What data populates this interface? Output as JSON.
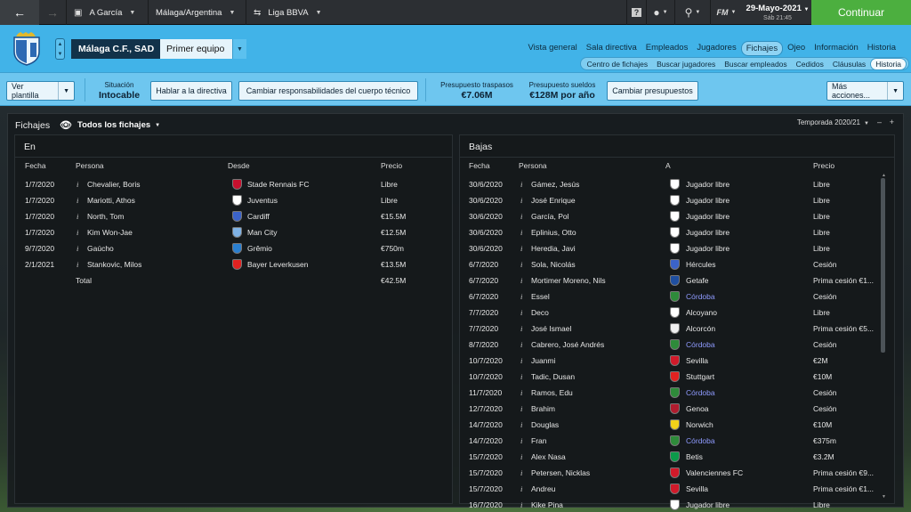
{
  "topbar": {
    "breadcrumbs": [
      {
        "label": "A García",
        "icon": "car-icon"
      },
      {
        "label": "Málaga/Argentina",
        "icon": "none"
      },
      {
        "label": "Liga BBVA",
        "icon": "swap-icon"
      }
    ],
    "date": "29-Mayo-2021",
    "time": "Sáb 21:45",
    "fm_label": "FM",
    "continue_label": "Continuar"
  },
  "header": {
    "club_name": "Málaga C.F., SAD",
    "team": "Primer equipo",
    "tabs": [
      "Vista general",
      "Sala directiva",
      "Empleados",
      "Jugadores",
      "Fichajes",
      "Ojeo",
      "Información",
      "Historia"
    ],
    "active_tab": "Fichajes",
    "subtabs": [
      "Centro de fichajes",
      "Buscar jugadores",
      "Buscar empleados",
      "Cedidos",
      "Cláusulas",
      "Historia"
    ],
    "active_subtab": "Historia"
  },
  "toolbar": {
    "squad_btn": "Ver plantilla",
    "situation_label": "Situación",
    "situation_value": "Intocable",
    "board_btn": "Hablar a la directiva",
    "staff_btn": "Cambiar responsabilidades del cuerpo técnico",
    "transfer_budget_label": "Presupuesto traspasos",
    "transfer_budget_value": "€7.06M",
    "wage_budget_label": "Presupuesto sueldos",
    "wage_budget_value": "€128M por año",
    "budget_btn": "Cambiar presupuestos",
    "more_btn": "Más acciones..."
  },
  "panel": {
    "title": "Fichajes",
    "filter": "Todos los fichajes",
    "season": "Temporada 2020/21"
  },
  "in": {
    "title": "En",
    "headers": {
      "date": "Fecha",
      "person": "Persona",
      "from": "Desde",
      "fee": "Precio"
    },
    "rows": [
      {
        "date": "1/7/2020",
        "person": "Chevalier, Boris",
        "club": "Stade Rennais FC",
        "fee": "Libre",
        "color": "#c8102e"
      },
      {
        "date": "1/7/2020",
        "person": "Mariotti, Athos",
        "club": "Juventus",
        "fee": "Libre",
        "color": "#ffffff"
      },
      {
        "date": "1/7/2020",
        "person": "North, Tom",
        "club": "Cardiff",
        "fee": "€15.5M",
        "color": "#3b63c9"
      },
      {
        "date": "1/7/2020",
        "person": "Kim Won-Jae",
        "club": "Man City",
        "fee": "€12.5M",
        "color": "#7fb2e5"
      },
      {
        "date": "9/7/2020",
        "person": "Gaúcho",
        "club": "Grêmio",
        "fee": "€750m",
        "color": "#2a7fd0"
      },
      {
        "date": "2/1/2021",
        "person": "Stankovic, Milos",
        "club": "Bayer Leverkusen",
        "fee": "€13.5M",
        "color": "#e32221"
      }
    ],
    "total_label": "Total",
    "total_value": "€42.5M"
  },
  "out": {
    "title": "Bajas",
    "headers": {
      "date": "Fecha",
      "person": "Persona",
      "to": "A",
      "fee": "Precio"
    },
    "rows": [
      {
        "date": "30/6/2020",
        "person": "Gámez, Jesús",
        "club": "Jugador libre",
        "fee": "Libre",
        "color": "#ffffff",
        "link": false
      },
      {
        "date": "30/6/2020",
        "person": "José Enrique",
        "club": "Jugador libre",
        "fee": "Libre",
        "color": "#ffffff",
        "link": false
      },
      {
        "date": "30/6/2020",
        "person": "García, Pol",
        "club": "Jugador libre",
        "fee": "Libre",
        "color": "#ffffff",
        "link": false
      },
      {
        "date": "30/6/2020",
        "person": "Eplinius, Otto",
        "club": "Jugador libre",
        "fee": "Libre",
        "color": "#ffffff",
        "link": false
      },
      {
        "date": "30/6/2020",
        "person": "Heredia, Javi",
        "club": "Jugador libre",
        "fee": "Libre",
        "color": "#ffffff",
        "link": false
      },
      {
        "date": "6/7/2020",
        "person": "Sola, Nicolás",
        "club": "Hércules",
        "fee": "Cesión",
        "color": "#3b63c9",
        "link": false
      },
      {
        "date": "6/7/2020",
        "person": "Mortimer Moreno, Nils",
        "club": "Getafe",
        "fee": "Prima cesión €1...",
        "color": "#1f4fa0",
        "link": false
      },
      {
        "date": "6/7/2020",
        "person": "Essel",
        "club": "Córdoba",
        "fee": "Cesión",
        "color": "#2e8b3a",
        "link": true
      },
      {
        "date": "7/7/2020",
        "person": "Deco",
        "club": "Alcoyano",
        "fee": "Libre",
        "color": "#ffffff",
        "link": false
      },
      {
        "date": "7/7/2020",
        "person": "José Ismael",
        "club": "Alcorcón",
        "fee": "Prima cesión €5...",
        "color": "#f0f0f0",
        "link": false
      },
      {
        "date": "8/7/2020",
        "person": "Cabrero, José Andrés",
        "club": "Córdoba",
        "fee": "Cesión",
        "color": "#2e8b3a",
        "link": true
      },
      {
        "date": "10/7/2020",
        "person": "Juanmi",
        "club": "Sevilla",
        "fee": "€2M",
        "color": "#d11a2a",
        "link": false
      },
      {
        "date": "10/7/2020",
        "person": "Tadic, Dusan",
        "club": "Stuttgart",
        "fee": "€10M",
        "color": "#e32221",
        "link": false
      },
      {
        "date": "11/7/2020",
        "person": "Ramos, Edu",
        "club": "Córdoba",
        "fee": "Cesión",
        "color": "#2e8b3a",
        "link": true
      },
      {
        "date": "12/7/2020",
        "person": "Brahim",
        "club": "Genoa",
        "fee": "Cesión",
        "color": "#b01c2e",
        "link": false
      },
      {
        "date": "14/7/2020",
        "person": "Douglas",
        "club": "Norwich",
        "fee": "€10M",
        "color": "#f3d21a",
        "link": false
      },
      {
        "date": "14/7/2020",
        "person": "Fran",
        "club": "Córdoba",
        "fee": "€375m",
        "color": "#2e8b3a",
        "link": true
      },
      {
        "date": "15/7/2020",
        "person": "Alex Nasa",
        "club": "Betis",
        "fee": "€3.2M",
        "color": "#0b9a4a",
        "link": false
      },
      {
        "date": "15/7/2020",
        "person": "Petersen, Nicklas",
        "club": "Valenciennes FC",
        "fee": "Prima cesión €9...",
        "color": "#d11a2a",
        "link": false
      },
      {
        "date": "15/7/2020",
        "person": "Andreu",
        "club": "Sevilla",
        "fee": "Prima cesión €1...",
        "color": "#d11a2a",
        "link": false
      },
      {
        "date": "16/7/2020",
        "person": "Kike Pina",
        "club": "Jugador libre",
        "fee": "Libre",
        "color": "#ffffff",
        "link": false
      }
    ]
  }
}
